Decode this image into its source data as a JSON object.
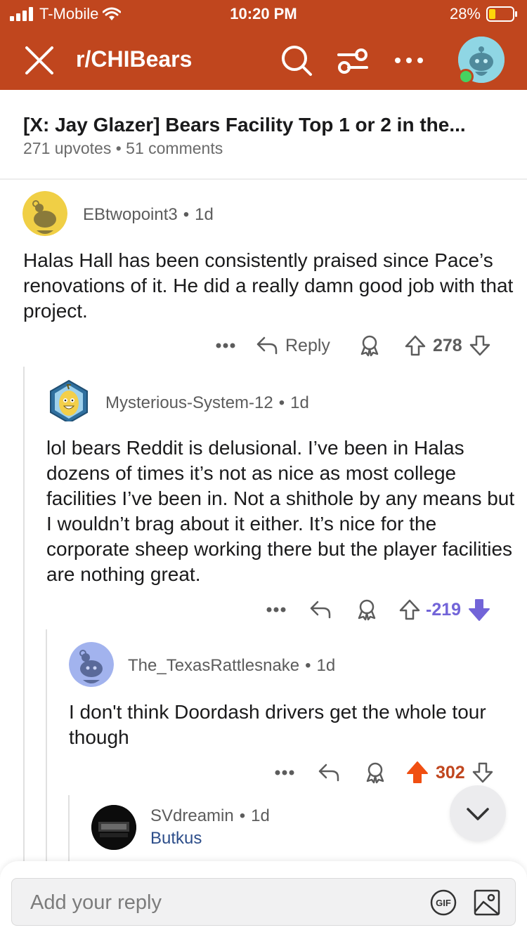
{
  "status_bar": {
    "carrier": "T-Mobile",
    "time": "10:20 PM",
    "battery": "28%"
  },
  "nav": {
    "subreddit": "r/CHIBears"
  },
  "post": {
    "title": "[X: Jay Glazer] Bears Facility Top 1 or 2 in the...",
    "upvotes": "271 upvotes",
    "comments": "51 comments"
  },
  "comments": [
    {
      "user": "EBtwopoint3",
      "age": "1d",
      "body": "Halas Hall has been consistently praised since Pace’s renovations of it. He did a really damn good job with that project.",
      "reply_label": "Reply",
      "score": "278"
    },
    {
      "user": "Mysterious-System-12",
      "age": "1d",
      "body": "lol bears Reddit is delusional.  I’ve been in Halas dozens of times it’s not as nice as most college facilities I’ve been in.  Not a shithole by any means but I wouldn’t brag about it either.  It’s nice for the corporate sheep working there but the player facilities are nothing great.",
      "score": "-219"
    },
    {
      "user": "The_TexasRattlesnake",
      "age": "1d",
      "body": "I don't think Doordash drivers get the whole tour though",
      "score": "302"
    },
    {
      "user": "SVdreamin",
      "age": "1d",
      "flair": "Butkus"
    }
  ],
  "reply_bar": {
    "placeholder": "Add your reply",
    "gif_label": "GIF"
  },
  "colors": {
    "header": "#c0461e",
    "downvote": "#7264d8",
    "upvote": "#f04f12"
  }
}
